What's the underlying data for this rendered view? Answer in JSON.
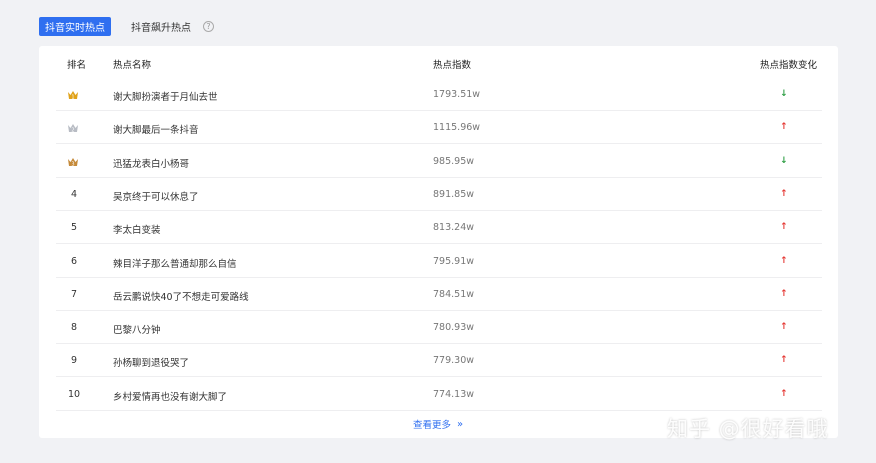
{
  "tabs": [
    {
      "label": "抖音实时热点",
      "active": true
    },
    {
      "label": "抖音飙升热点",
      "active": false
    }
  ],
  "help_icon": "question-circle-icon",
  "table": {
    "headers": {
      "rank": "排名",
      "name": "热点名称",
      "index": "热点指数",
      "change": "热点指数变化"
    },
    "rows": [
      {
        "rank": "1",
        "medal": "gold",
        "name": "谢大脚扮演者于月仙去世",
        "index": "1793.51w",
        "change": "down"
      },
      {
        "rank": "2",
        "medal": "silver",
        "name": "谢大脚最后一条抖音",
        "index": "1115.96w",
        "change": "up"
      },
      {
        "rank": "3",
        "medal": "bronze",
        "name": "迅猛龙表白小杨哥",
        "index": "985.95w",
        "change": "down"
      },
      {
        "rank": "4",
        "name": "吴京终于可以休息了",
        "index": "891.85w",
        "change": "up"
      },
      {
        "rank": "5",
        "name": "李太白变装",
        "index": "813.24w",
        "change": "up"
      },
      {
        "rank": "6",
        "name": "辣目洋子那么普通却那么自信",
        "index": "795.91w",
        "change": "up"
      },
      {
        "rank": "7",
        "name": "岳云鹏说快40了不想走可爱路线",
        "index": "784.51w",
        "change": "up"
      },
      {
        "rank": "8",
        "name": "巴黎八分钟",
        "index": "780.93w",
        "change": "up"
      },
      {
        "rank": "9",
        "name": "孙杨聊到退役哭了",
        "index": "779.30w",
        "change": "up"
      },
      {
        "rank": "10",
        "name": "乡村爱情再也没有谢大脚了",
        "index": "774.13w",
        "change": "up"
      }
    ]
  },
  "more_link": "查看更多",
  "watermark": "知乎 @很好看哦",
  "colors": {
    "accent": "#2f6ff0",
    "up": "#e53935",
    "down": "#2e9e44",
    "gold": "#e0a21a",
    "silver": "#b8bcc4",
    "bronze": "#c58a3a"
  }
}
